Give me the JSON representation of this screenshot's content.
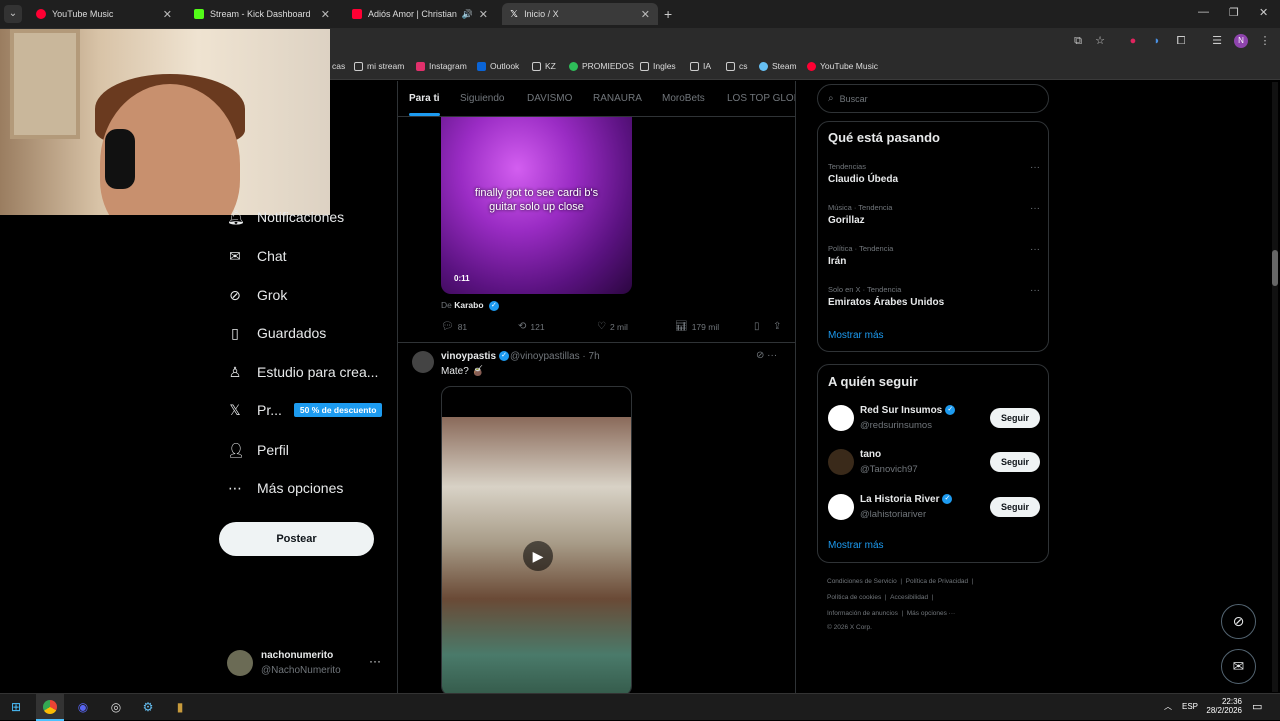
{
  "browser": {
    "tabs": [
      {
        "title": "YouTube Music",
        "color": "#ff0033"
      },
      {
        "title": "Stream - Kick Dashboard",
        "color": "#53fc18"
      },
      {
        "title": "Adiós Amor | Christian Nod",
        "color": "#ff0033"
      },
      {
        "title": "Inicio / X",
        "color": "#ffffff"
      }
    ],
    "bookmarks": [
      {
        "label": "cas",
        "color": "#888"
      },
      {
        "label": "mi stream",
        "color": "#aaa"
      },
      {
        "label": "Instagram",
        "color": "#e1306c"
      },
      {
        "label": "Outlook",
        "color": "#0a64d6"
      },
      {
        "label": "KZ",
        "color": "#aaa"
      },
      {
        "label": "PROMIEDOS",
        "color": "#2ebd59"
      },
      {
        "label": "Ingles",
        "color": "#aaa"
      },
      {
        "label": "IA",
        "color": "#aaa"
      },
      {
        "label": "cs",
        "color": "#aaa"
      },
      {
        "label": "Steam",
        "color": "#66c0f4"
      },
      {
        "label": "YouTube Music",
        "color": "#ff0033"
      }
    ],
    "profile_initial": "N"
  },
  "nav": {
    "notifications": "Notificaciones",
    "chat": "Chat",
    "grok": "Grok",
    "saved": "Guardados",
    "studio": "Estudio para crea...",
    "premium": "Pr...",
    "premium_badge": "50 % de descuento",
    "profile": "Perfil",
    "more": "Más opciones",
    "post_button": "Postear"
  },
  "account": {
    "name": "nachonumerito",
    "handle": "@NachoNumerito"
  },
  "feed": {
    "tabs": [
      "Para ti",
      "Siguiendo",
      "DAVISMO",
      "RANAURA",
      "MoroBets",
      "LOS TOP GLOBA"
    ],
    "post1": {
      "caption_line1": "finally got to see cardi b's",
      "caption_line2": "guitar solo up close",
      "duration": "0:11",
      "from_prefix": "De",
      "from_name": "Karabo",
      "replies": "81",
      "reposts": "121",
      "likes": "2 mil",
      "views": "179 mil"
    },
    "post2": {
      "name": "vinoypastis",
      "handle": "@vinoypastillas · 7h",
      "text": "Mate? 🧉"
    }
  },
  "sidebar": {
    "search_placeholder": "Buscar",
    "trending_title": "Qué está pasando",
    "trends": [
      {
        "category": "Tendencias",
        "name": "Claudio Úbeda"
      },
      {
        "category": "Música · Tendencia",
        "name": "Gorillaz"
      },
      {
        "category": "Política · Tendencia",
        "name": "Irán"
      },
      {
        "category": "Solo en X · Tendencia",
        "name": "Emiratos Árabes Unidos"
      }
    ],
    "show_more": "Mostrar más",
    "follow_title": "A quién seguir",
    "follow": [
      {
        "name": "Red Sur Insumos",
        "handle": "@redsurinsumos",
        "button": "Seguir"
      },
      {
        "name": "tano",
        "handle": "@Tanovich97",
        "button": "Seguir"
      },
      {
        "name": "La Historia River",
        "handle": "@lahistoriariver",
        "button": "Seguir"
      }
    ],
    "footer": {
      "terms": "Condiciones de Servicio",
      "privacy": "Política de Privacidad",
      "cookies": "Política de cookies",
      "accessibility": "Accesibilidad",
      "ads": "Información de anuncios",
      "more": "Más opciones ···",
      "copyright": "© 2026 X Corp."
    }
  },
  "taskbar": {
    "lang": "ESP",
    "time": "22:36",
    "date": "28/2/2026"
  }
}
